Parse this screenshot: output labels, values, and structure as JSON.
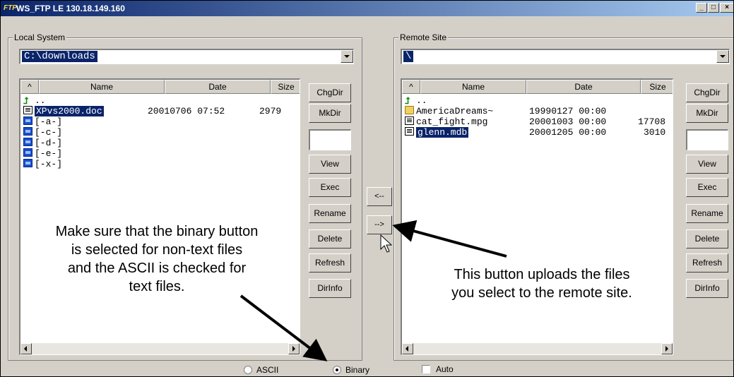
{
  "window": {
    "title": "WS_FTP LE 130.18.149.160",
    "icon": "ftp-app-icon",
    "controls": {
      "minimize": "_",
      "maximize": "□",
      "close": "×"
    }
  },
  "local": {
    "group_label": "Local System",
    "path": "C:\\downloads",
    "columns": {
      "sort": "^",
      "name": "Name",
      "date": "Date",
      "size": "Size"
    },
    "rows": [
      {
        "name": "..",
        "date": "",
        "size": "",
        "icon": "up-arrow-icon",
        "selected": false
      },
      {
        "name": "XPvs2000.doc",
        "date": "20010706 07:52",
        "size": "2979",
        "icon": "file-icon",
        "selected": true
      },
      {
        "name": "[-a-]",
        "date": "",
        "size": "",
        "icon": "drive-icon",
        "selected": false
      },
      {
        "name": "[-c-]",
        "date": "",
        "size": "",
        "icon": "drive-icon",
        "selected": false
      },
      {
        "name": "[-d-]",
        "date": "",
        "size": "",
        "icon": "drive-icon",
        "selected": false
      },
      {
        "name": "[-e-]",
        "date": "",
        "size": "",
        "icon": "drive-icon",
        "selected": false
      },
      {
        "name": "[-x-]",
        "date": "",
        "size": "",
        "icon": "drive-icon",
        "selected": false
      }
    ],
    "buttons": {
      "chgdir": "ChgDir",
      "mkdir": "MkDir",
      "view": "View",
      "exec": "Exec",
      "rename": "Rename",
      "delete": "Delete",
      "refresh": "Refresh",
      "dirinfo": "DirInfo"
    }
  },
  "remote": {
    "group_label": "Remote Site",
    "path": "\\",
    "columns": {
      "sort": "^",
      "name": "Name",
      "date": "Date",
      "size": "Size"
    },
    "rows": [
      {
        "name": "..",
        "date": "",
        "size": "",
        "icon": "up-arrow-icon",
        "selected": false
      },
      {
        "name": "AmericaDreams~",
        "date": "19990127 00:00",
        "size": "",
        "icon": "folder-icon",
        "selected": false
      },
      {
        "name": "cat_fight.mpg",
        "date": "20001003 00:00",
        "size": "17708",
        "icon": "file-icon",
        "selected": false
      },
      {
        "name": "glenn.mdb",
        "date": "20001205 00:00",
        "size": "3010",
        "icon": "file-icon",
        "selected": true
      }
    ],
    "buttons": {
      "chgdir": "ChgDir",
      "mkdir": "MkDir",
      "view": "View",
      "exec": "Exec",
      "rename": "Rename",
      "delete": "Delete",
      "refresh": "Refresh",
      "dirinfo": "DirInfo"
    }
  },
  "transfer": {
    "download": "<--",
    "upload": "-->"
  },
  "mode": {
    "ascii": "ASCII",
    "binary": "Binary",
    "selected": "binary",
    "auto": "Auto",
    "auto_checked": false
  },
  "annotations": {
    "left": [
      "Make sure that the binary button",
      "is selected for non-text files",
      "and the ASCII is checked for",
      "text files."
    ],
    "right": [
      "This button uploads the files",
      "you select to the remote site."
    ]
  },
  "colors": {
    "title_bar": "#0a246a",
    "selection": "#0a246a",
    "face": "#d4d0c8",
    "up_arrow": "#0a8a0a"
  }
}
